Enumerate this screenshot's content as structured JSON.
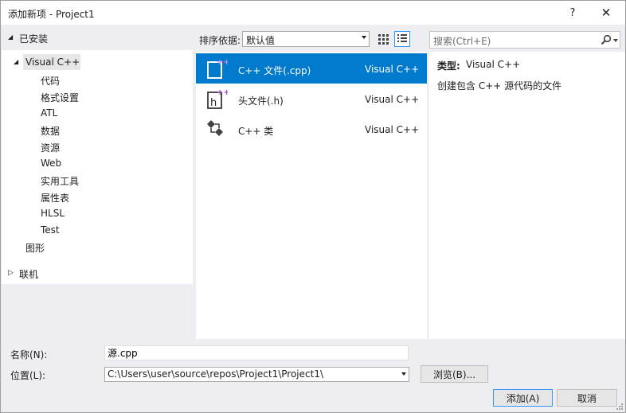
{
  "window": {
    "title": "添加新项 - Project1",
    "help": "?",
    "close": "✕"
  },
  "tree": {
    "installed": "已安装",
    "visual_cpp": "Visual C++",
    "children": [
      "代码",
      "格式设置",
      "ATL",
      "数据",
      "资源",
      "Web",
      "实用工具",
      "属性表",
      "HLSL",
      "Test"
    ],
    "graphics": "图形",
    "online": "联机"
  },
  "toolbar": {
    "sort_label": "排序依据:",
    "sort_value": "默认值",
    "search_placeholder": "搜索(Ctrl+E)"
  },
  "templates": [
    {
      "name": "C++ 文件(.cpp)",
      "lang": "Visual C++",
      "icon": "cpp-file-icon",
      "selected": true
    },
    {
      "name": "头文件(.h)",
      "lang": "Visual C++",
      "icon": "header-file-icon",
      "selected": false
    },
    {
      "name": "C++ 类",
      "lang": "Visual C++",
      "icon": "cpp-class-icon",
      "selected": false
    }
  ],
  "details": {
    "type_label": "类型:",
    "type_value": "Visual C++",
    "description": "创建包含 C++ 源代码的文件"
  },
  "form": {
    "name_label": "名称(N):",
    "name_value": "源.cpp",
    "location_label": "位置(L):",
    "location_value": "C:\\Users\\user\\source\\repos\\Project1\\Project1\\",
    "browse": "浏览(B)...",
    "add": "添加(A)",
    "cancel": "取消"
  },
  "colors": {
    "accent": "#007acc",
    "background": "#eeeef2"
  }
}
